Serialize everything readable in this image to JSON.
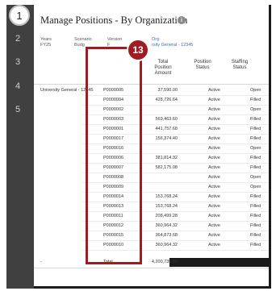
{
  "steps": [
    {
      "number": "1",
      "active": true
    },
    {
      "number": "2"
    },
    {
      "number": "3"
    },
    {
      "number": "4"
    },
    {
      "number": "5"
    }
  ],
  "title": "Manage Positions - By Organization",
  "filters": {
    "years": {
      "label": "Years",
      "value": "FY25"
    },
    "scenario": {
      "label": "Scenario",
      "value": "Budg"
    },
    "version": {
      "label": "Version",
      "value": "F"
    },
    "org": {
      "label": "Org",
      "value": "rsity General - 12345"
    }
  },
  "columns": {
    "total_position_amount": "Total Position Amount",
    "position_status": "Position Status",
    "staffing_status": "Staffing Status"
  },
  "org_name": "University General - 12345",
  "rows": [
    {
      "position": "P0000005",
      "amount": "37,590.00",
      "position_status": "Active",
      "staffing": "Open"
    },
    {
      "position": "P0000004",
      "amount": "428,726.64",
      "position_status": "Active",
      "staffing": "Filled"
    },
    {
      "position": "P0000002",
      "amount": "",
      "position_status": "Active",
      "staffing": "Open"
    },
    {
      "position": "P0000003",
      "amount": "569,463.60",
      "position_status": "Active",
      "staffing": "Filled"
    },
    {
      "position": "P0000001",
      "amount": "441,757.68",
      "position_status": "Active",
      "staffing": "Filled"
    },
    {
      "position": "P0000017",
      "amount": "156,374.40",
      "position_status": "Active",
      "staffing": "Filled"
    },
    {
      "position": "P0000016",
      "amount": "",
      "position_status": "Active",
      "staffing": "Open"
    },
    {
      "position": "P0000006",
      "amount": "381,814.32",
      "position_status": "Active",
      "staffing": "Filled"
    },
    {
      "position": "P0000007",
      "amount": "582,175.08",
      "position_status": "Active",
      "staffing": "Filled"
    },
    {
      "position": "P0000008",
      "amount": "",
      "position_status": "Active",
      "staffing": "Open"
    },
    {
      "position": "P0000009",
      "amount": "",
      "position_status": "Active",
      "staffing": "Open"
    },
    {
      "position": "P0000014",
      "amount": "153,768.24",
      "position_status": "Active",
      "staffing": "Filled"
    },
    {
      "position": "P0000013",
      "amount": "153,768.24",
      "position_status": "Active",
      "staffing": "Filled"
    },
    {
      "position": "P0000011",
      "amount": "208,499.28",
      "position_status": "Active",
      "staffing": "Filled"
    },
    {
      "position": "P0000012",
      "amount": "360,964.32",
      "position_status": "Active",
      "staffing": "Filled"
    },
    {
      "position": "P0000015",
      "amount": "364,873.68",
      "position_status": "Active",
      "staffing": "Filled"
    },
    {
      "position": "P0000010",
      "amount": "360,964.32",
      "position_status": "Active",
      "staffing": "Filled"
    }
  ],
  "total_row": {
    "org": "-",
    "label": "Total",
    "amount": "4,200,739.80"
  },
  "callout": {
    "number": "13",
    "color": "#9e1c22"
  }
}
